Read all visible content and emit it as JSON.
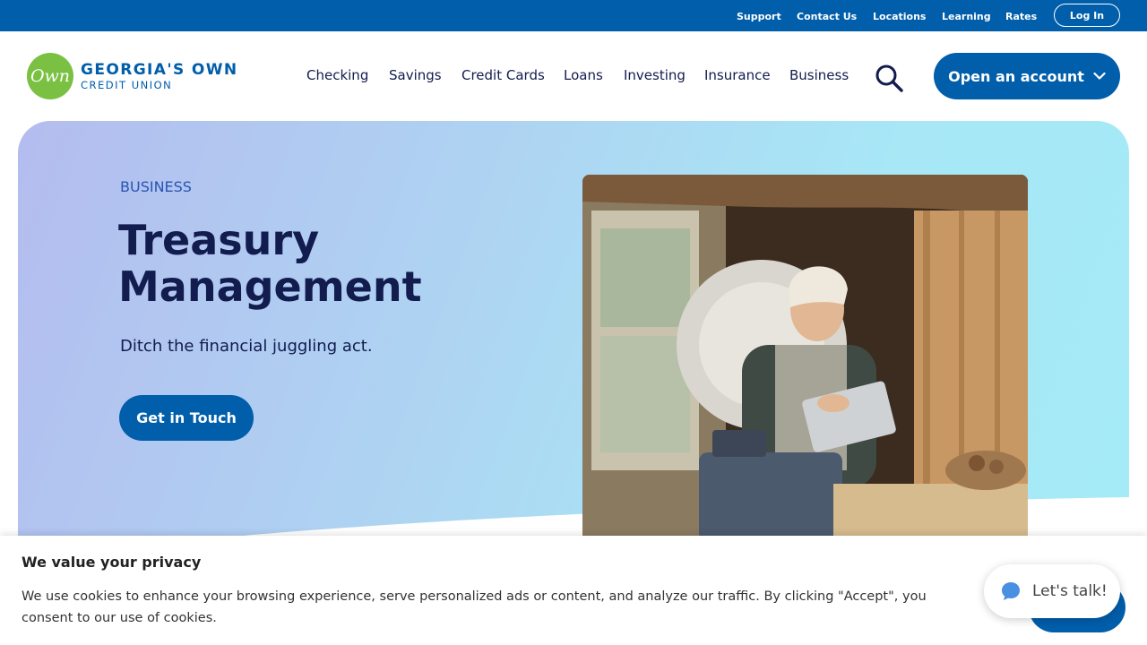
{
  "utility": {
    "links": [
      "Support",
      "Contact Us",
      "Locations",
      "Learning",
      "Rates"
    ],
    "login": "Log In"
  },
  "logo": {
    "badge": "Own",
    "name": "GEORGIA'S OWN",
    "sub": "CREDIT UNION"
  },
  "nav": {
    "items": [
      "Checking",
      "Savings",
      "Credit Cards",
      "Loans",
      "Investing",
      "Insurance",
      "Business"
    ],
    "cta": "Open an account"
  },
  "hero": {
    "eyebrow": "BUSINESS",
    "title": "Treasury Management",
    "subtitle": "Ditch the financial juggling act.",
    "cta": "Get in Touch"
  },
  "cookie": {
    "title": "We value your privacy",
    "body": "We use cookies to enhance your browsing experience, serve personalized ads or content, and analyze our traffic. By clicking \"Accept\", you consent to our use of cookies."
  },
  "chat": {
    "label": "Let's talk!"
  },
  "colors": {
    "brand_blue": "#005eaa",
    "logo_green": "#7ac143",
    "text_navy": "#121c4e"
  },
  "icons": {
    "search": "search-icon",
    "chevron": "chevron-down-icon",
    "chat": "chat-bubble-icon"
  }
}
